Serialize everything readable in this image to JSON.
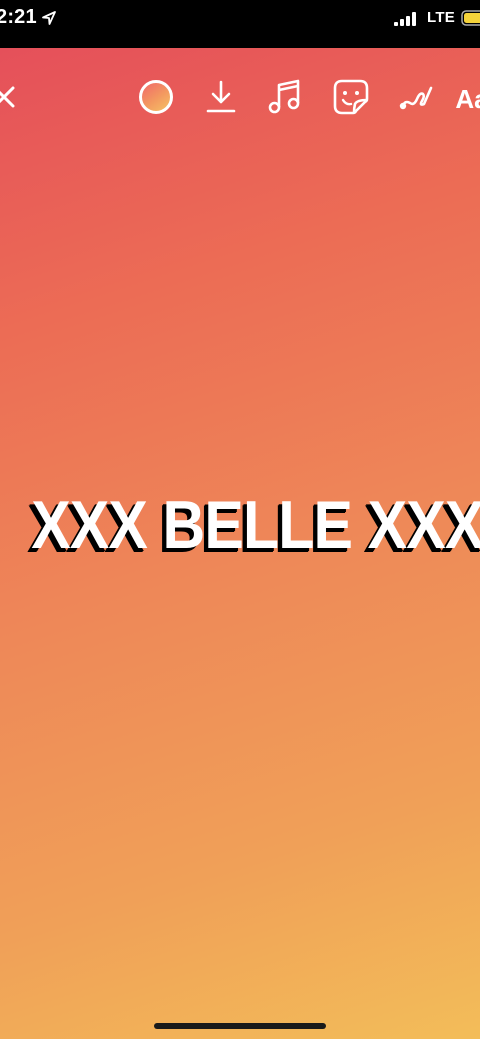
{
  "status_bar": {
    "time": "2:21",
    "network": "LTE",
    "icons": [
      "location-arrow-icon",
      "signal-bars-icon",
      "battery-icon"
    ],
    "battery_color": "#f5d33a"
  },
  "toolbar": {
    "icons": [
      "close-icon",
      "color-swatch-icon",
      "download-icon",
      "music-note-icon",
      "sticker-icon",
      "scribble-draw-icon"
    ],
    "text_tool_label": "Aa"
  },
  "canvas": {
    "gradient_colors": [
      "#e5505a",
      "#ee8858",
      "#f3bd59"
    ],
    "story_text": "XXX BELLE XXX",
    "text_color": "#ffffff",
    "text_shadow_color": "#000000"
  }
}
